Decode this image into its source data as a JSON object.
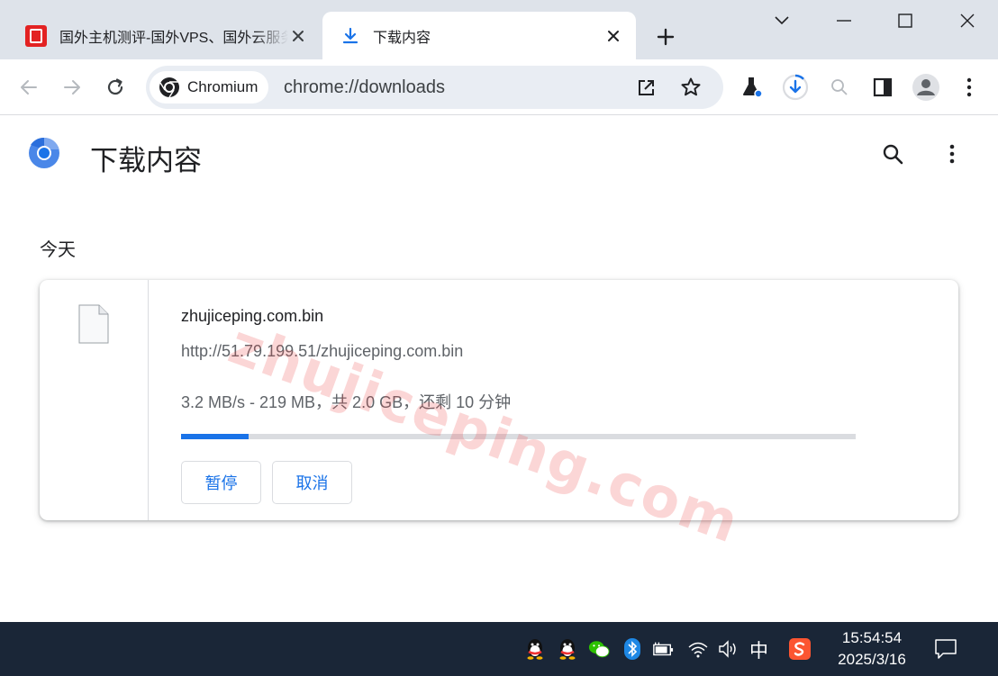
{
  "tabs": [
    {
      "title": "国外主机测评-国外VPS、国外云服务器、国外独立服务器",
      "active": false,
      "favicon": "site-logo-icon"
    },
    {
      "title": "下载内容",
      "active": true,
      "favicon": "download-icon"
    }
  ],
  "omnibox": {
    "chip_label": "Chromium",
    "url": "chrome://downloads"
  },
  "page": {
    "title": "下载内容",
    "section": "今天"
  },
  "download": {
    "file_name": "zhujiceping.com.bin",
    "url": "http://51.79.199.51/zhujiceping.com.bin",
    "status": "3.2 MB/s - 219 MB，共 2.0 GB，还剩 10 分钟",
    "progress_fraction": 0.1,
    "pause_label": "暂停",
    "cancel_label": "取消"
  },
  "watermark": "zhujiceping.com",
  "taskbar": {
    "ime": "中",
    "time": "15:54:54",
    "date": "2025/3/16"
  },
  "colors": {
    "accent": "#1a73e8",
    "tabstrip": "#dee3ea",
    "omnibox": "#e9edf3",
    "taskbar": "#1a2637",
    "watermark": "#eb4646"
  }
}
